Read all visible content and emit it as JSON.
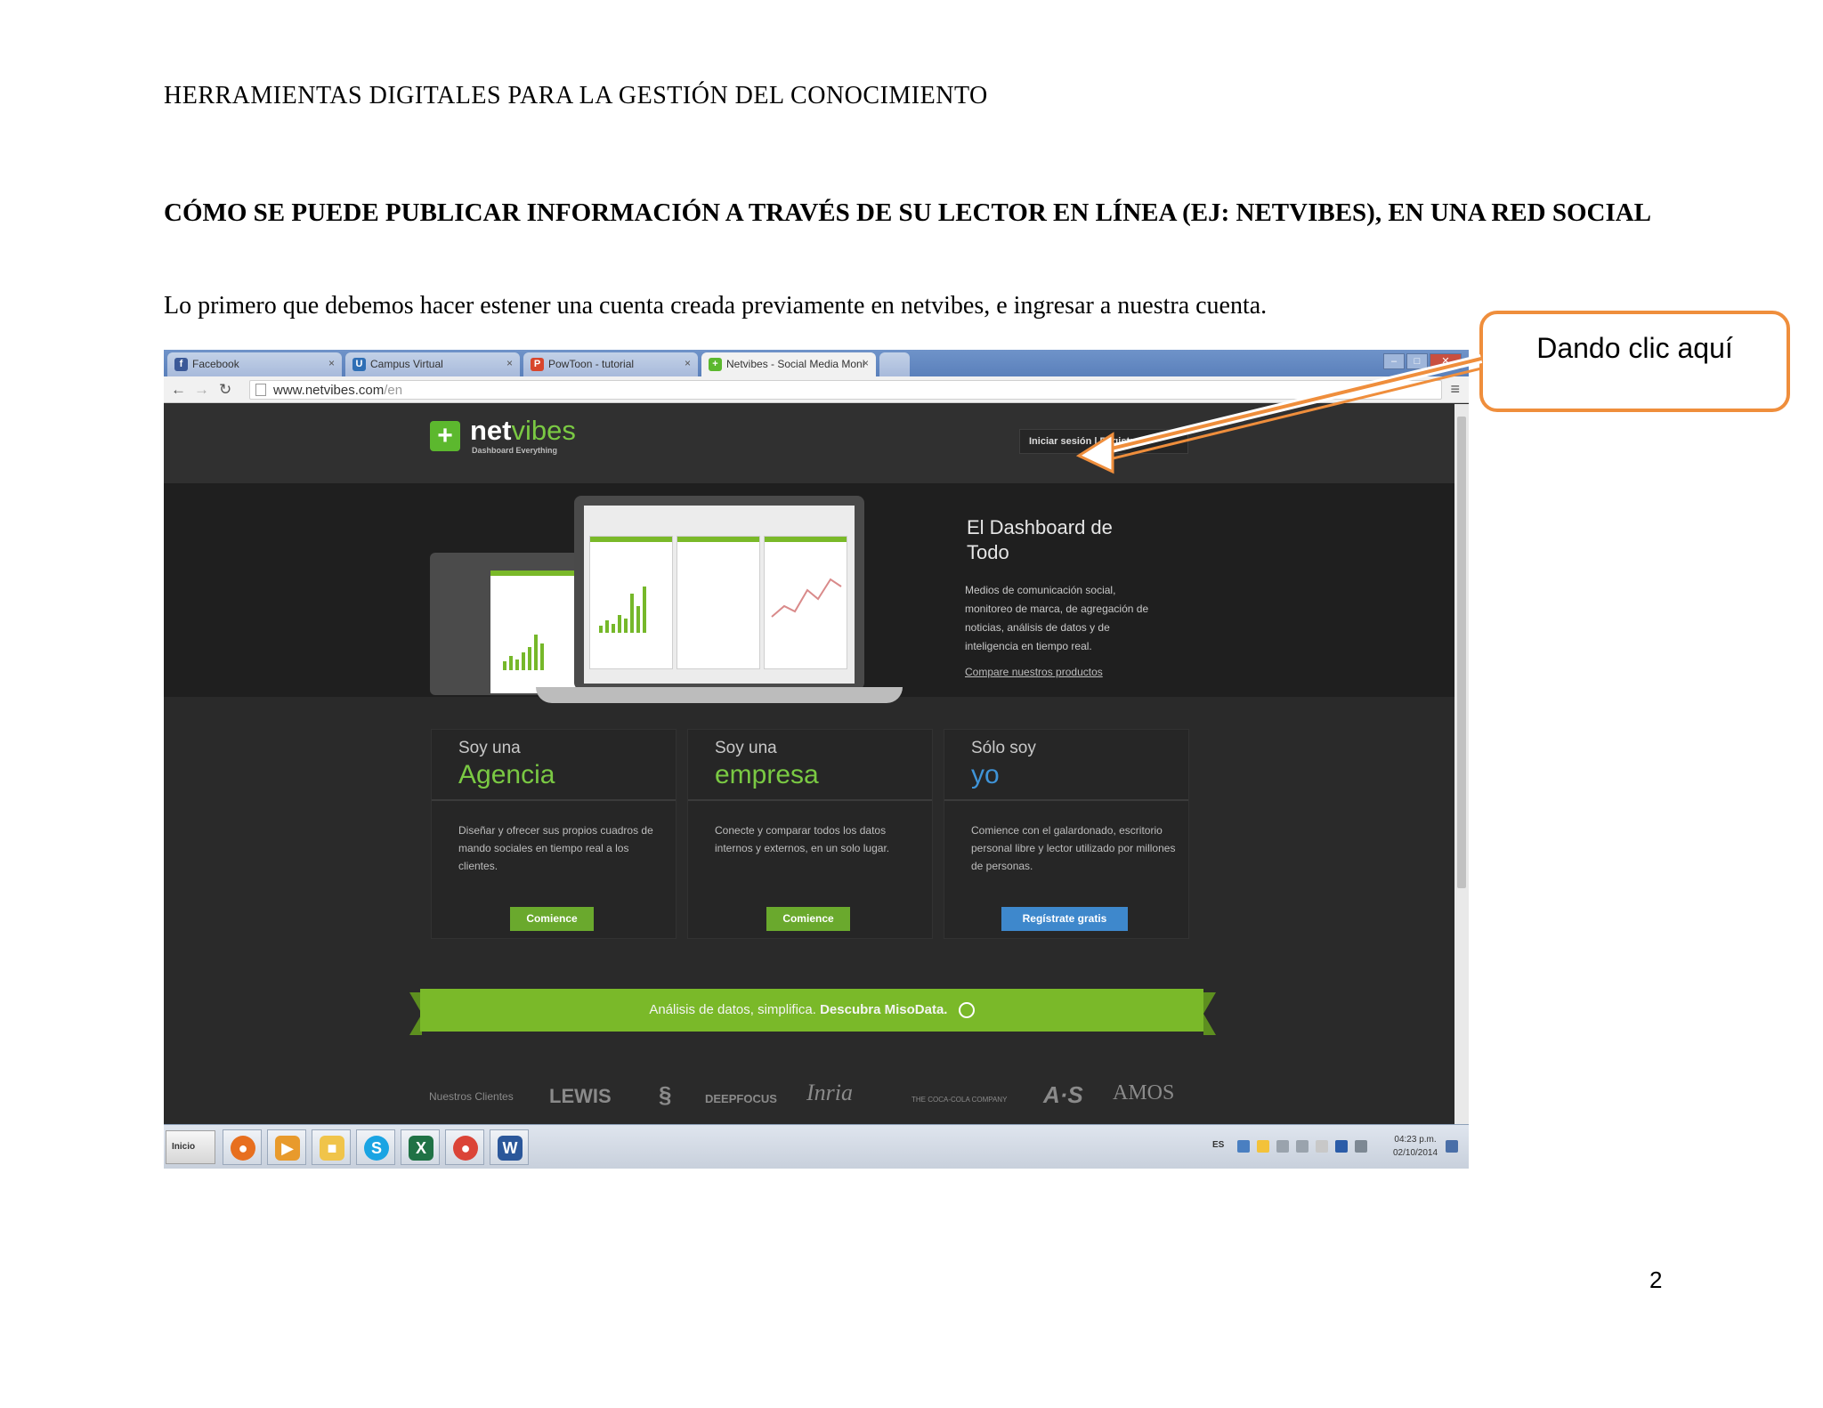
{
  "document": {
    "header": "HERRAMIENTAS  DIGITALES  PARA LA GESTIÓN DEL  CONOCIMIENTO",
    "section_title": "CÓMO SE PUEDE PUBLICAR  INFORMACIÓN A TRAVÉS DE SU LECTOR EN LÍNEA (EJ: NETVIBES), EN UNA RED SOCIAL",
    "intro": "Lo primero  que  debemos  hacer  estener  una  cuenta  creada  previamente  en netvibes,  e ingresar  a nuestra  cuenta.",
    "page_number": "2",
    "callout": "Dando clic aquí",
    "callout_color": "#ef8e3c"
  },
  "browser": {
    "tabs": [
      {
        "icon": "f",
        "icon_color": "#3b5998",
        "label": "Facebook"
      },
      {
        "icon": "U",
        "icon_color": "#2f6fb5",
        "label": "Campus Virtual"
      },
      {
        "icon": "P",
        "icon_color": "#d8462c",
        "label": "PowToon - tutorial"
      },
      {
        "icon": "+",
        "icon_color": "#5cb82e",
        "label": "Netvibes - Social Media Moni"
      }
    ],
    "tab_close": "×",
    "url_host": "www.netvibes.com",
    "url_path": "/en"
  },
  "site": {
    "logo_net": "net",
    "logo_vibes": "vibes",
    "logo_tagline": "Dashboard Everything",
    "login_label": "Iniciar sesión  |  Registrar",
    "hero_title": "El Dashboard de Todo",
    "hero_desc": "Medios de comunicación social, monitoreo de marca, de agregación de noticias, análisis de datos y de inteligencia en tiempo real.",
    "hero_link": "Compare nuestros productos",
    "cards": [
      {
        "small": "Soy una",
        "big": "Agencia",
        "body": "Diseñar y ofrecer sus propios cuadros de mando sociales en tiempo real a los clientes.",
        "button": "Comience"
      },
      {
        "small": "Soy una",
        "big": "empresa",
        "body": "Conecte y comparar todos los datos internos y externos, en un solo lugar.",
        "button": "Comience"
      },
      {
        "small": "Sólo soy",
        "big": "yo",
        "body": "Comience con el galardonado, escritorio personal libre y lector utilizado por millones de personas.",
        "button": "Regístrate gratis"
      }
    ],
    "banner_text": "Análisis de datos, simplifica.",
    "banner_bold": "Descubra MisoData.",
    "clients_label": "Nuestros Clientes",
    "clients": [
      "LEWIS",
      "DEEPFOCUS",
      "Inria",
      "THE COCA-COLA COMPANY",
      "A·S",
      "AMOS"
    ]
  },
  "taskbar": {
    "start": "Inicio",
    "apps": [
      {
        "name": "firefox",
        "glyph": "●",
        "color": "#e76f1f"
      },
      {
        "name": "media-player",
        "glyph": "▶",
        "color": "#e89a2c"
      },
      {
        "name": "folder",
        "glyph": "■",
        "color": "#f0c44a"
      },
      {
        "name": "skype",
        "glyph": "S",
        "color": "#1aa4e3"
      },
      {
        "name": "excel",
        "glyph": "X",
        "color": "#207245"
      },
      {
        "name": "chrome",
        "glyph": "●",
        "color": "#db4437"
      },
      {
        "name": "word",
        "glyph": "W",
        "color": "#2b579a"
      }
    ],
    "lang": "ES",
    "time": "04:23 p.m.",
    "date": "02/10/2014"
  }
}
